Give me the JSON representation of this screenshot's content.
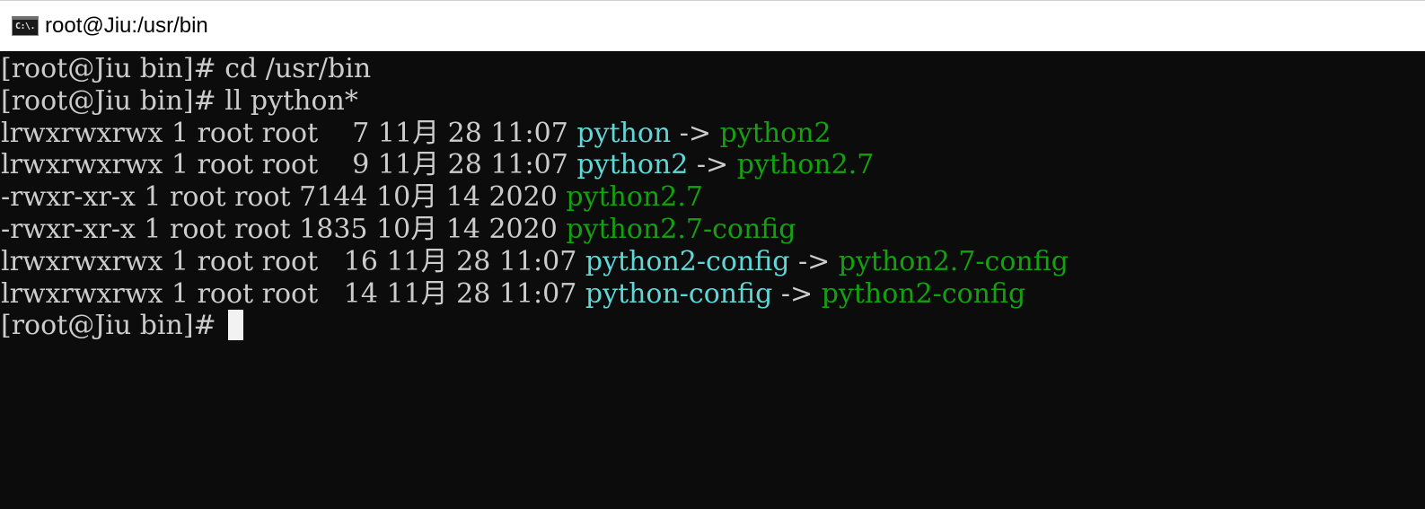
{
  "window": {
    "title": "root@Jiu:/usr/bin",
    "icon": "cmd-icon",
    "icon_glyph": "C:\\."
  },
  "colors": {
    "background": "#0c0c0c",
    "text": "#cccccc",
    "symlink": "#61d6d6",
    "target": "#13a10e",
    "cursor": "#f2f2f2"
  },
  "terminal": {
    "prompt1": "[root@Jiu bin]# cd /usr/bin",
    "prompt2": "[root@Jiu bin]# ll python*",
    "rows": [
      {
        "meta": "lrwxrwxrwx 1 root root    7 11月 28 11:07 ",
        "name": "python",
        "arrow": " -> ",
        "target": "python2"
      },
      {
        "meta": "lrwxrwxrwx 1 root root    9 11月 28 11:07 ",
        "name": "python2",
        "arrow": " -> ",
        "target": "python2.7"
      },
      {
        "meta": "-rwxr-xr-x 1 root root 7144 10月 14 2020 ",
        "name": "python2.7"
      },
      {
        "meta": "-rwxr-xr-x 1 root root 1835 10月 14 2020 ",
        "name": "python2.7-config"
      },
      {
        "meta": "lrwxrwxrwx 1 root root   16 11月 28 11:07 ",
        "name": "python2-config",
        "arrow": " -> ",
        "target": "python2.7-config"
      },
      {
        "meta": "lrwxrwxrwx 1 root root   14 11月 28 11:07 ",
        "name": "python-config",
        "arrow": " -> ",
        "target": "python2-config"
      }
    ],
    "prompt3": "[root@Jiu bin]# "
  }
}
